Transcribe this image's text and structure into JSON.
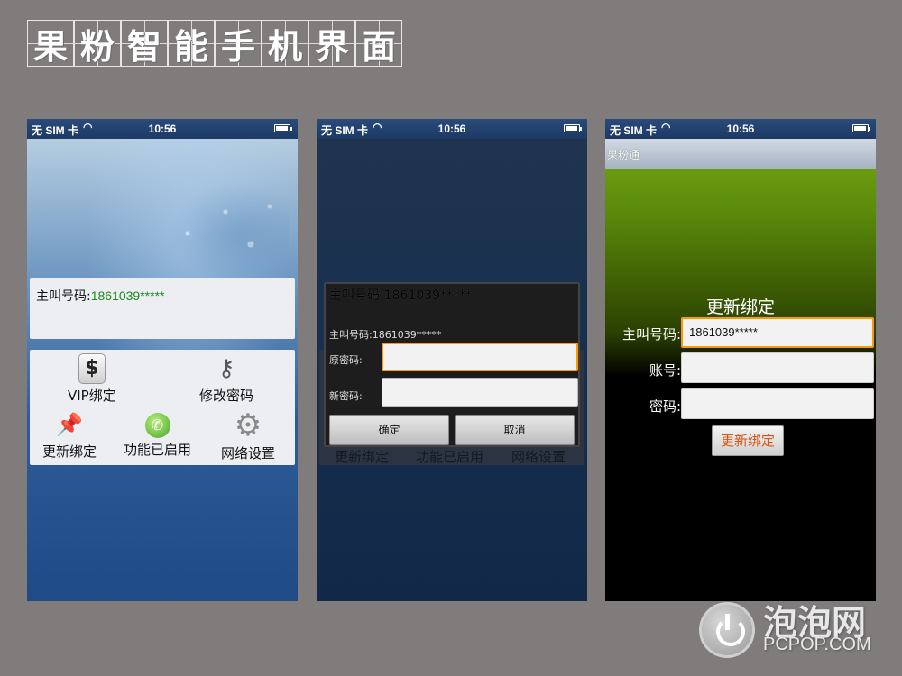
{
  "page_title": [
    "果",
    "粉",
    "智",
    "能",
    "手",
    "机",
    "界",
    "面"
  ],
  "statusbar": {
    "sim": "无 SIM 卡",
    "time": "10:56"
  },
  "screen1": {
    "caller_label": "主叫号码:",
    "caller_number": "1861039*****",
    "grid": {
      "vip": "VIP绑定",
      "change_pwd": "修改密码",
      "update_bind": "更新绑定",
      "enabled": "功能已启用",
      "network": "网络设置"
    }
  },
  "screen2": {
    "ghost_title": "主叫号码:1861039*****",
    "caller_line": "主叫号码:1861039*****",
    "old_pwd_label": "原密码:",
    "new_pwd_label": "新密码:",
    "confirm": "确定",
    "cancel": "取消",
    "behind": {
      "update_bind": "更新绑定",
      "enabled": "功能已启用",
      "network": "网络设置"
    }
  },
  "screen3": {
    "app_title": "果粉通",
    "heading": "更新绑定",
    "caller_label": "主叫号码:",
    "caller_value": "1861039*****",
    "account_label": "账号:",
    "password_label": "密码:",
    "update_button": "更新绑定"
  },
  "watermark": {
    "name": "泡泡网",
    "site": "PCPOP.COM"
  }
}
